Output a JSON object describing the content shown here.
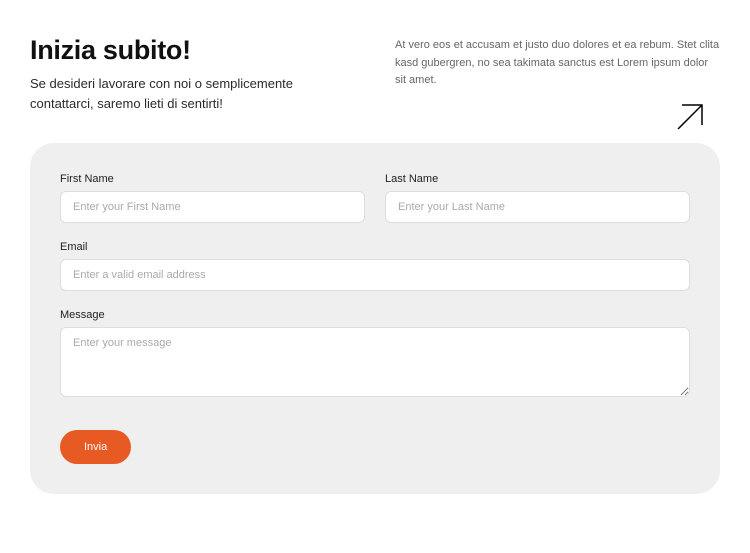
{
  "header": {
    "title": "Inizia subito!",
    "subtitle": "Se desideri lavorare con noi o semplicemente contattarci, saremo lieti di sentirti!",
    "description": "At vero eos et accusam et justo duo dolores et ea rebum. Stet clita kasd gubergren, no sea takimata sanctus est Lorem ipsum dolor sit amet."
  },
  "form": {
    "firstName": {
      "label": "First Name",
      "placeholder": "Enter your First Name"
    },
    "lastName": {
      "label": "Last Name",
      "placeholder": "Enter your Last Name"
    },
    "email": {
      "label": "Email",
      "placeholder": "Enter a valid email address"
    },
    "message": {
      "label": "Message",
      "placeholder": "Enter your message"
    },
    "submit": "Invia"
  },
  "colors": {
    "accent": "#e85a24",
    "formBg": "#efefef"
  }
}
